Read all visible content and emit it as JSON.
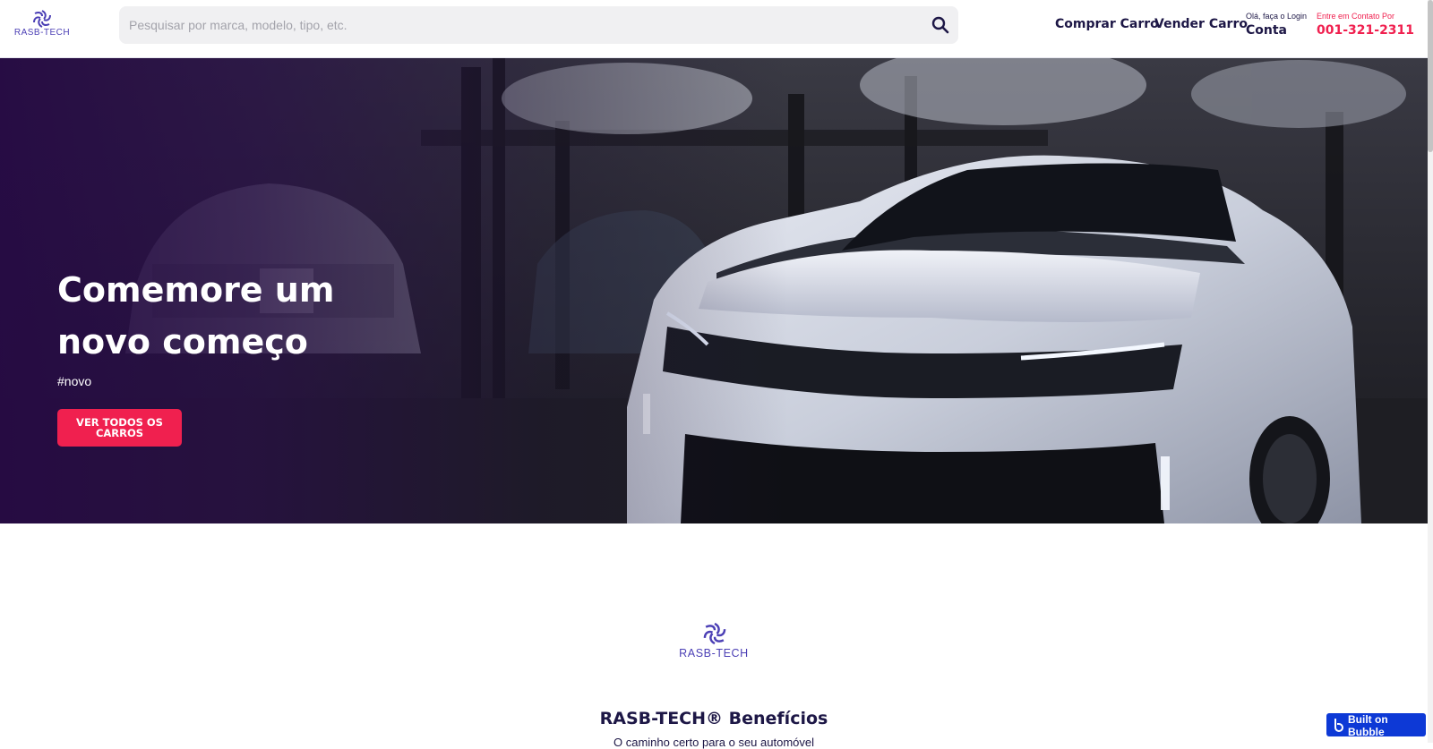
{
  "header": {
    "logo_text": "RASB-TECH",
    "search": {
      "placeholder": "Pesquisar por marca, modelo, tipo, etc."
    },
    "nav": {
      "buy": "Comprar Carro",
      "sell": "Vender Carro",
      "login_hint": "Olá, faça o Login",
      "account": "Conta",
      "contact_hint": "Entre em Contato Por",
      "phone": "001-321-2311"
    }
  },
  "hero": {
    "title": "Comemore um novo começo",
    "tag": "#novo",
    "cta": "VER TODOS OS CARROS"
  },
  "benefits": {
    "logo_text": "RASB-TECH",
    "title": "RASB-TECH® Benefícios",
    "subtitle": "O caminho certo para o seu automóvel"
  },
  "badge": {
    "label": "Built on Bubble"
  },
  "colors": {
    "brand_navy": "#1d1746",
    "brand_purple": "#4b3fb5",
    "accent_pink": "#f0204f",
    "bubble_blue": "#0d39d6"
  },
  "icons": {
    "search": "search-icon",
    "logo": "rasb-tech-logo-icon",
    "bubble": "bubble-logo-icon"
  }
}
